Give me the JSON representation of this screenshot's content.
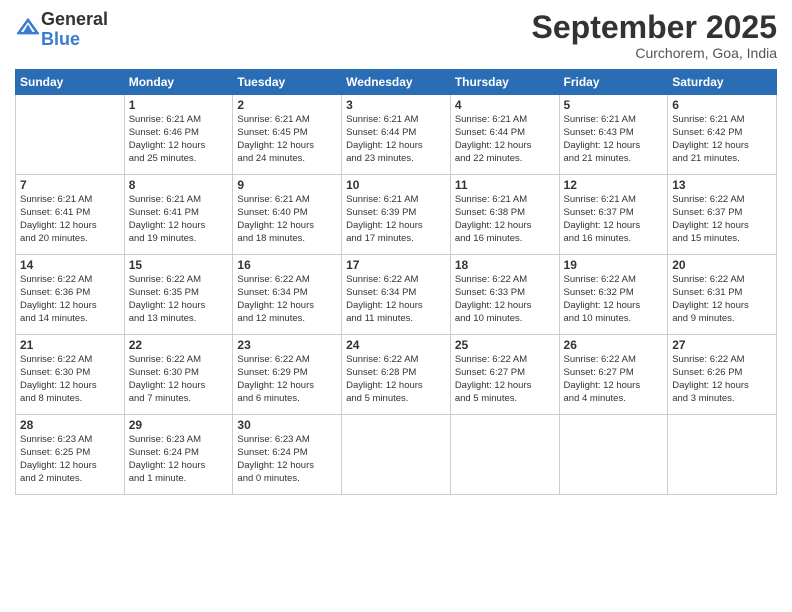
{
  "header": {
    "logo_general": "General",
    "logo_blue": "Blue",
    "month_title": "September 2025",
    "location": "Curchorem, Goa, India"
  },
  "weekdays": [
    "Sunday",
    "Monday",
    "Tuesday",
    "Wednesday",
    "Thursday",
    "Friday",
    "Saturday"
  ],
  "weeks": [
    [
      {
        "day": "",
        "sunrise": "",
        "sunset": "",
        "daylight": ""
      },
      {
        "day": "1",
        "sunrise": "6:21 AM",
        "sunset": "6:46 PM",
        "daylight": "12 hours and 25 minutes."
      },
      {
        "day": "2",
        "sunrise": "6:21 AM",
        "sunset": "6:45 PM",
        "daylight": "12 hours and 24 minutes."
      },
      {
        "day": "3",
        "sunrise": "6:21 AM",
        "sunset": "6:44 PM",
        "daylight": "12 hours and 23 minutes."
      },
      {
        "day": "4",
        "sunrise": "6:21 AM",
        "sunset": "6:44 PM",
        "daylight": "12 hours and 22 minutes."
      },
      {
        "day": "5",
        "sunrise": "6:21 AM",
        "sunset": "6:43 PM",
        "daylight": "12 hours and 21 minutes."
      },
      {
        "day": "6",
        "sunrise": "6:21 AM",
        "sunset": "6:42 PM",
        "daylight": "12 hours and 21 minutes."
      }
    ],
    [
      {
        "day": "7",
        "sunrise": "6:21 AM",
        "sunset": "6:41 PM",
        "daylight": "12 hours and 20 minutes."
      },
      {
        "day": "8",
        "sunrise": "6:21 AM",
        "sunset": "6:41 PM",
        "daylight": "12 hours and 19 minutes."
      },
      {
        "day": "9",
        "sunrise": "6:21 AM",
        "sunset": "6:40 PM",
        "daylight": "12 hours and 18 minutes."
      },
      {
        "day": "10",
        "sunrise": "6:21 AM",
        "sunset": "6:39 PM",
        "daylight": "12 hours and 17 minutes."
      },
      {
        "day": "11",
        "sunrise": "6:21 AM",
        "sunset": "6:38 PM",
        "daylight": "12 hours and 16 minutes."
      },
      {
        "day": "12",
        "sunrise": "6:21 AM",
        "sunset": "6:37 PM",
        "daylight": "12 hours and 16 minutes."
      },
      {
        "day": "13",
        "sunrise": "6:22 AM",
        "sunset": "6:37 PM",
        "daylight": "12 hours and 15 minutes."
      }
    ],
    [
      {
        "day": "14",
        "sunrise": "6:22 AM",
        "sunset": "6:36 PM",
        "daylight": "12 hours and 14 minutes."
      },
      {
        "day": "15",
        "sunrise": "6:22 AM",
        "sunset": "6:35 PM",
        "daylight": "12 hours and 13 minutes."
      },
      {
        "day": "16",
        "sunrise": "6:22 AM",
        "sunset": "6:34 PM",
        "daylight": "12 hours and 12 minutes."
      },
      {
        "day": "17",
        "sunrise": "6:22 AM",
        "sunset": "6:34 PM",
        "daylight": "12 hours and 11 minutes."
      },
      {
        "day": "18",
        "sunrise": "6:22 AM",
        "sunset": "6:33 PM",
        "daylight": "12 hours and 10 minutes."
      },
      {
        "day": "19",
        "sunrise": "6:22 AM",
        "sunset": "6:32 PM",
        "daylight": "12 hours and 10 minutes."
      },
      {
        "day": "20",
        "sunrise": "6:22 AM",
        "sunset": "6:31 PM",
        "daylight": "12 hours and 9 minutes."
      }
    ],
    [
      {
        "day": "21",
        "sunrise": "6:22 AM",
        "sunset": "6:30 PM",
        "daylight": "12 hours and 8 minutes."
      },
      {
        "day": "22",
        "sunrise": "6:22 AM",
        "sunset": "6:30 PM",
        "daylight": "12 hours and 7 minutes."
      },
      {
        "day": "23",
        "sunrise": "6:22 AM",
        "sunset": "6:29 PM",
        "daylight": "12 hours and 6 minutes."
      },
      {
        "day": "24",
        "sunrise": "6:22 AM",
        "sunset": "6:28 PM",
        "daylight": "12 hours and 5 minutes."
      },
      {
        "day": "25",
        "sunrise": "6:22 AM",
        "sunset": "6:27 PM",
        "daylight": "12 hours and 5 minutes."
      },
      {
        "day": "26",
        "sunrise": "6:22 AM",
        "sunset": "6:27 PM",
        "daylight": "12 hours and 4 minutes."
      },
      {
        "day": "27",
        "sunrise": "6:22 AM",
        "sunset": "6:26 PM",
        "daylight": "12 hours and 3 minutes."
      }
    ],
    [
      {
        "day": "28",
        "sunrise": "6:23 AM",
        "sunset": "6:25 PM",
        "daylight": "12 hours and 2 minutes."
      },
      {
        "day": "29",
        "sunrise": "6:23 AM",
        "sunset": "6:24 PM",
        "daylight": "12 hours and 1 minute."
      },
      {
        "day": "30",
        "sunrise": "6:23 AM",
        "sunset": "6:24 PM",
        "daylight": "12 hours and 0 minutes."
      },
      {
        "day": "",
        "sunrise": "",
        "sunset": "",
        "daylight": ""
      },
      {
        "day": "",
        "sunrise": "",
        "sunset": "",
        "daylight": ""
      },
      {
        "day": "",
        "sunrise": "",
        "sunset": "",
        "daylight": ""
      },
      {
        "day": "",
        "sunrise": "",
        "sunset": "",
        "daylight": ""
      }
    ]
  ],
  "labels": {
    "sunrise": "Sunrise:",
    "sunset": "Sunset:",
    "daylight": "Daylight:"
  }
}
